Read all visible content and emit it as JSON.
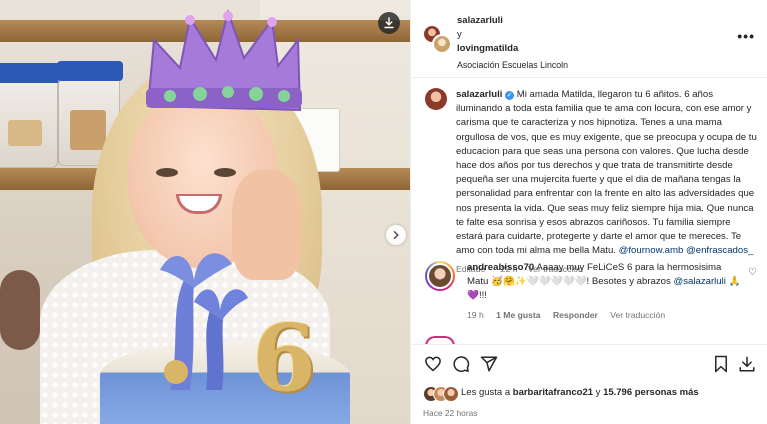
{
  "post": {
    "header": {
      "author1": "salazarluli",
      "conjunction": "y",
      "author2": "lovingmatilda",
      "location": "Asociación Escuelas Lincoln",
      "more_icon": "more-horizontal-icon"
    },
    "caption": {
      "username": "salazarluli",
      "text": "Mi amada Matilda, llegaron tu 6 añitos. 6 años iluminando a toda esta familia que te ama con locura, con ese amor y carisma que te caracteriza y nos hipnotiza. Tenes a una mama orgullosa de vos, que es muy exigente, que se preocupa y ocupa de tu educacion para que seas una persona con valores. Que lucha desde hace dos años por tus derechos y que trata de transmitirte desde pequeña ser una mujercita fuerte y que el dia de mañana tengas la personalidad para enfrentar con la frente en alto las adversidades que nos presenta la vida. Que seas muy feliz siempre hija mia. Que nunca te falte esa sonrisa y esos abrazos cariñosos. Tu familia siempre estará para cuidarte, protegerte y darte el amor que te mereces. Te amo con toda mi alma me bella Matu.",
      "mention1": "@fournow.amb",
      "mention2": "@enfrascados_",
      "edited": "Editado",
      "time": "22 h",
      "translate": "Ver traducción"
    },
    "comment": {
      "username": "andreabisso70",
      "text": "Aaaay muy FeLiCeS 6 para la hermosisima Matu 🥳🤗✨🤍🤍🤍🤍🤍! Besotes y abrazos",
      "mention": "@salazarluli",
      "emojis_end": "🙏💜!!!",
      "time": "19 h",
      "likes": "1 Me gusta",
      "reply": "Responder",
      "translate": "Ver traducción"
    },
    "likes": {
      "prefix": "Les gusta a",
      "user": "barbaritafranco21",
      "middle": "y",
      "count": "15.796 personas más"
    },
    "posted_ago": "Hace 22 horas",
    "colors": {
      "link": "#00376b",
      "verified": "#3897f0",
      "meta": "#737373"
    }
  }
}
